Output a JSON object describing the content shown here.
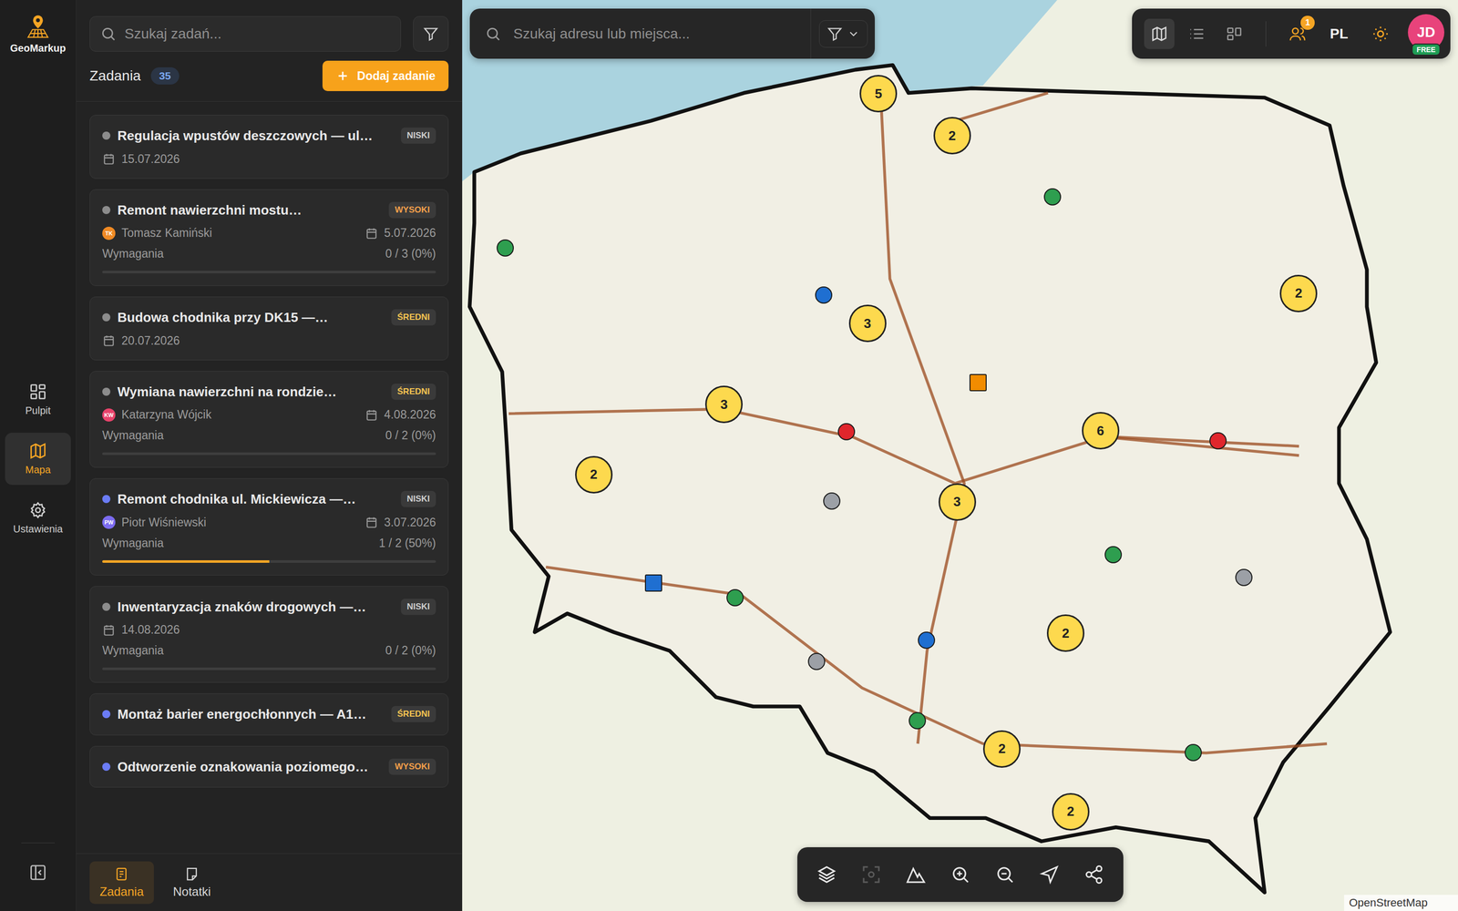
{
  "app": {
    "name": "GeoMarkup"
  },
  "nav": [
    {
      "label": "Pulpit",
      "selected": false
    },
    {
      "label": "Mapa",
      "selected": true
    },
    {
      "label": "Ustawienia",
      "selected": false
    }
  ],
  "tasks_panel": {
    "search": {
      "placeholder": "Szukaj zadań..."
    },
    "title": "Zadania",
    "count": "35",
    "add_button": "Dodaj zadanie",
    "tasks": [
      {
        "title": "Regulacja wpustów deszczowych — ul…",
        "status_color": "#8c8c8c",
        "priority": {
          "label": "NISKI",
          "color": "#cfcfcf"
        },
        "assignee": null,
        "date": "15.07.2026",
        "requirements": null
      },
      {
        "title": "Remont nawierzchni mostu…",
        "status_color": "#8c8c8c",
        "priority": {
          "label": "WYSOKI",
          "color": "#f5a04a"
        },
        "assignee": {
          "name": "Tomasz Kamiński",
          "initials": "TK",
          "color": "#f08a24"
        },
        "date": "5.07.2026",
        "requirements": {
          "label": "Wymagania",
          "reading": "0 / 3 (0%)",
          "level": 0
        }
      },
      {
        "title": "Budowa chodnika przy DK15 —…",
        "status_color": "#8c8c8c",
        "priority": {
          "label": "ŚREDNI",
          "color": "#f5c451"
        },
        "assignee": null,
        "date": "20.07.2026",
        "requirements": null
      },
      {
        "title": "Wymiana nawierzchni na rondzie…",
        "status_color": "#8c8c8c",
        "priority": {
          "label": "ŚREDNI",
          "color": "#f5c451"
        },
        "assignee": {
          "name": "Katarzyna Wójcik",
          "initials": "KW",
          "color": "#e8436b"
        },
        "date": "4.08.2026",
        "requirements": {
          "label": "Wymagania",
          "reading": "0 / 2 (0%)",
          "level": 0
        }
      },
      {
        "title": "Remont chodnika ul. Mickiewicza —…",
        "status_color": "#6b7cf5",
        "priority": {
          "label": "NISKI",
          "color": "#cfcfcf"
        },
        "assignee": {
          "name": "Piotr Wiśniewski",
          "initials": "PW",
          "color": "#7c6cf0"
        },
        "date": "3.07.2026",
        "requirements": {
          "label": "Wymagania",
          "reading": "1 / 2 (50%)",
          "level": 0.5
        }
      },
      {
        "title": "Inwentaryzacja znaków drogowych —…",
        "status_color": "#8c8c8c",
        "priority": {
          "label": "NISKI",
          "color": "#cfcfcf"
        },
        "assignee": null,
        "date": "14.08.2026",
        "requirements": {
          "label": "Wymagania",
          "reading": "0 / 2 (0%)",
          "level": 0
        }
      },
      {
        "title": "Montaż barier energochłonnych — A1…",
        "status_color": "#6b7cf5",
        "priority": {
          "label": "ŚREDNI",
          "color": "#f5c451"
        },
        "assignee": null,
        "date": null,
        "requirements": null
      },
      {
        "title": "Odtworzenie oznakowania poziomego…",
        "status_color": "#6b7cf5",
        "priority": {
          "label": "WYSOKI",
          "color": "#f5a04a"
        },
        "assignee": null,
        "date": null,
        "requirements": null
      }
    ]
  },
  "bottom_tabs": [
    {
      "label": "Zadania",
      "selected": true
    },
    {
      "label": "Notatki",
      "selected": false
    }
  ],
  "map": {
    "search": {
      "placeholder": "Szukaj adresu lub miejsca..."
    },
    "views": [
      {
        "selected": true
      },
      {
        "selected": false
      },
      {
        "selected": false
      }
    ],
    "notifications": "1",
    "language": "PL",
    "user": {
      "initials": "JD",
      "plan": "FREE"
    },
    "tools": [
      {
        "disabled": false
      },
      {
        "disabled": true
      },
      {
        "disabled": false
      },
      {
        "disabled": false
      },
      {
        "disabled": false
      },
      {
        "disabled": false
      },
      {
        "disabled": false
      }
    ],
    "markers": [
      {
        "kind": "cluster",
        "count": "5"
      },
      {
        "kind": "cluster",
        "count": "2"
      },
      {
        "kind": "cluster",
        "count": "2"
      },
      {
        "kind": "cluster",
        "count": "3"
      },
      {
        "kind": "cluster",
        "count": "3"
      },
      {
        "kind": "cluster",
        "count": "6"
      },
      {
        "kind": "cluster",
        "count": "2"
      },
      {
        "kind": "cluster",
        "count": "3"
      },
      {
        "kind": "cluster",
        "count": "2"
      },
      {
        "kind": "cluster",
        "count": "2"
      },
      {
        "kind": "cluster",
        "count": "2"
      },
      {
        "kind": "dot",
        "color": "#2e9e4f"
      },
      {
        "kind": "dot",
        "color": "#2e9e4f"
      },
      {
        "kind": "dot",
        "color": "#1f6fd1"
      },
      {
        "kind": "dot",
        "color": "#e0262c"
      },
      {
        "kind": "dot",
        "color": "#e0262c"
      },
      {
        "kind": "dot",
        "color": "#9ca0a6"
      },
      {
        "kind": "dot",
        "color": "#2e9e4f"
      },
      {
        "kind": "dot",
        "color": "#9ca0a6"
      },
      {
        "kind": "dot",
        "color": "#2e9e4f"
      },
      {
        "kind": "dot",
        "color": "#1f6fd1"
      },
      {
        "kind": "dot",
        "color": "#9ca0a6"
      },
      {
        "kind": "dot",
        "color": "#2e9e4f"
      },
      {
        "kind": "dot",
        "color": "#2e9e4f"
      },
      {
        "kind": "square",
        "color": "#f28c00"
      },
      {
        "kind": "square",
        "color": "#1f6fd1"
      }
    ],
    "attribution": "OpenStreetMap"
  }
}
